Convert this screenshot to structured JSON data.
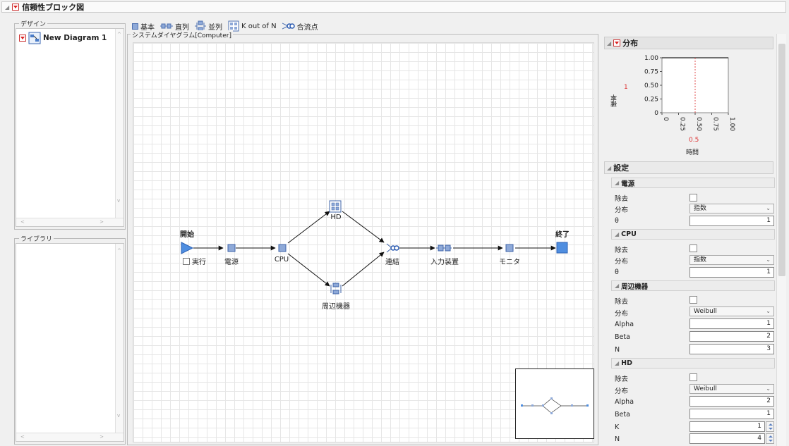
{
  "window": {
    "title": "信頼性ブロック図"
  },
  "design_panel": {
    "legend": "デザイン",
    "items": [
      {
        "label": "New Diagram 1"
      }
    ]
  },
  "library_panel": {
    "legend": "ライブラリ"
  },
  "toolbar": {
    "basic": "基本",
    "series": "直列",
    "parallel": "並列",
    "k_out_of_n": "K out of N",
    "junction": "合流点"
  },
  "diagram": {
    "legend": "システムダイヤグラム[Computer]",
    "start_label": "開始",
    "end_label": "終了",
    "run_label": "実行",
    "nodes": {
      "power": "電源",
      "cpu": "CPU",
      "hd": "HD",
      "peripheral": "周辺機器",
      "link": "連結",
      "input": "入力装置",
      "monitor": "モニタ"
    }
  },
  "distribution": {
    "title": "分布",
    "ylabel": "確率",
    "yvalue": "1",
    "xlabel": "時間",
    "xvalue": "0.5",
    "yticks": [
      "1.00",
      "0.75",
      "0.50",
      "0.25",
      "0"
    ],
    "xticks": [
      "0",
      "0.25",
      "0.50",
      "0.75",
      "1.00"
    ]
  },
  "chart_data": {
    "type": "line",
    "x": [
      0,
      1
    ],
    "y": [
      1,
      1
    ],
    "xlabel": "時間",
    "ylabel": "確率",
    "xlim": [
      0,
      1
    ],
    "ylim": [
      0,
      1
    ],
    "crosshair_x": 0.5
  },
  "settings": {
    "title": "設定",
    "sections": {
      "power": {
        "title": "電源",
        "remove": "除去",
        "dist_label": "分布",
        "dist": "指数",
        "theta_label": "θ",
        "theta": "1"
      },
      "cpu": {
        "title": "CPU",
        "remove": "除去",
        "dist_label": "分布",
        "dist": "指数",
        "theta_label": "θ",
        "theta": "1"
      },
      "peripheral": {
        "title": "周辺機器",
        "remove": "除去",
        "dist_label": "分布",
        "dist": "Weibull",
        "alpha_label": "Alpha",
        "alpha": "1",
        "beta_label": "Beta",
        "beta": "2",
        "n_label": "N",
        "n": "3"
      },
      "hd": {
        "title": "HD",
        "remove": "除去",
        "dist_label": "分布",
        "dist": "Weibull",
        "alpha_label": "Alpha",
        "alpha": "2",
        "beta_label": "Beta",
        "beta": "1",
        "k_label": "K",
        "k": "1",
        "n_label": "N",
        "n": "4"
      }
    }
  }
}
